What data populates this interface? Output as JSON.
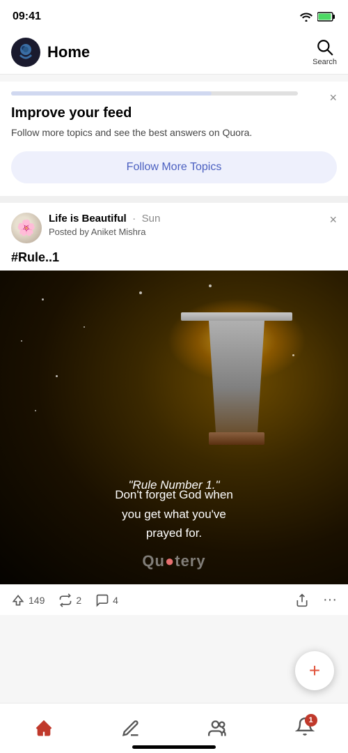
{
  "statusBar": {
    "time": "09:41"
  },
  "header": {
    "title": "Home",
    "search_label": "Search"
  },
  "improveCard": {
    "title": "Improve your feed",
    "description": "Follow more topics and see the best answers on Quora.",
    "button_label": "Follow More Topics",
    "progress_percent": 70
  },
  "postCard": {
    "space_name": "Life is Beautiful",
    "time": "Sun",
    "posted_by": "Posted by Aniket Mishra",
    "rule_tag": "#Rule..1",
    "quote_header": "\"Rule Number 1.\"",
    "quote_body": "Don't forget God when\nyou get what you've\nprayed for.",
    "brand_text": "Qu",
    "brand_dot": "●",
    "brand_rest": "tery",
    "upvotes": "149",
    "shares": "2",
    "comments": "4",
    "more_options": "···"
  },
  "nav": {
    "items": [
      {
        "name": "home",
        "label": "Home",
        "active": true
      },
      {
        "name": "edit",
        "label": "Edit",
        "active": false
      },
      {
        "name": "spaces",
        "label": "Spaces",
        "active": false
      },
      {
        "name": "bell",
        "label": "Notifications",
        "active": false,
        "badge": "1"
      }
    ]
  },
  "fab": {
    "icon": "+"
  }
}
